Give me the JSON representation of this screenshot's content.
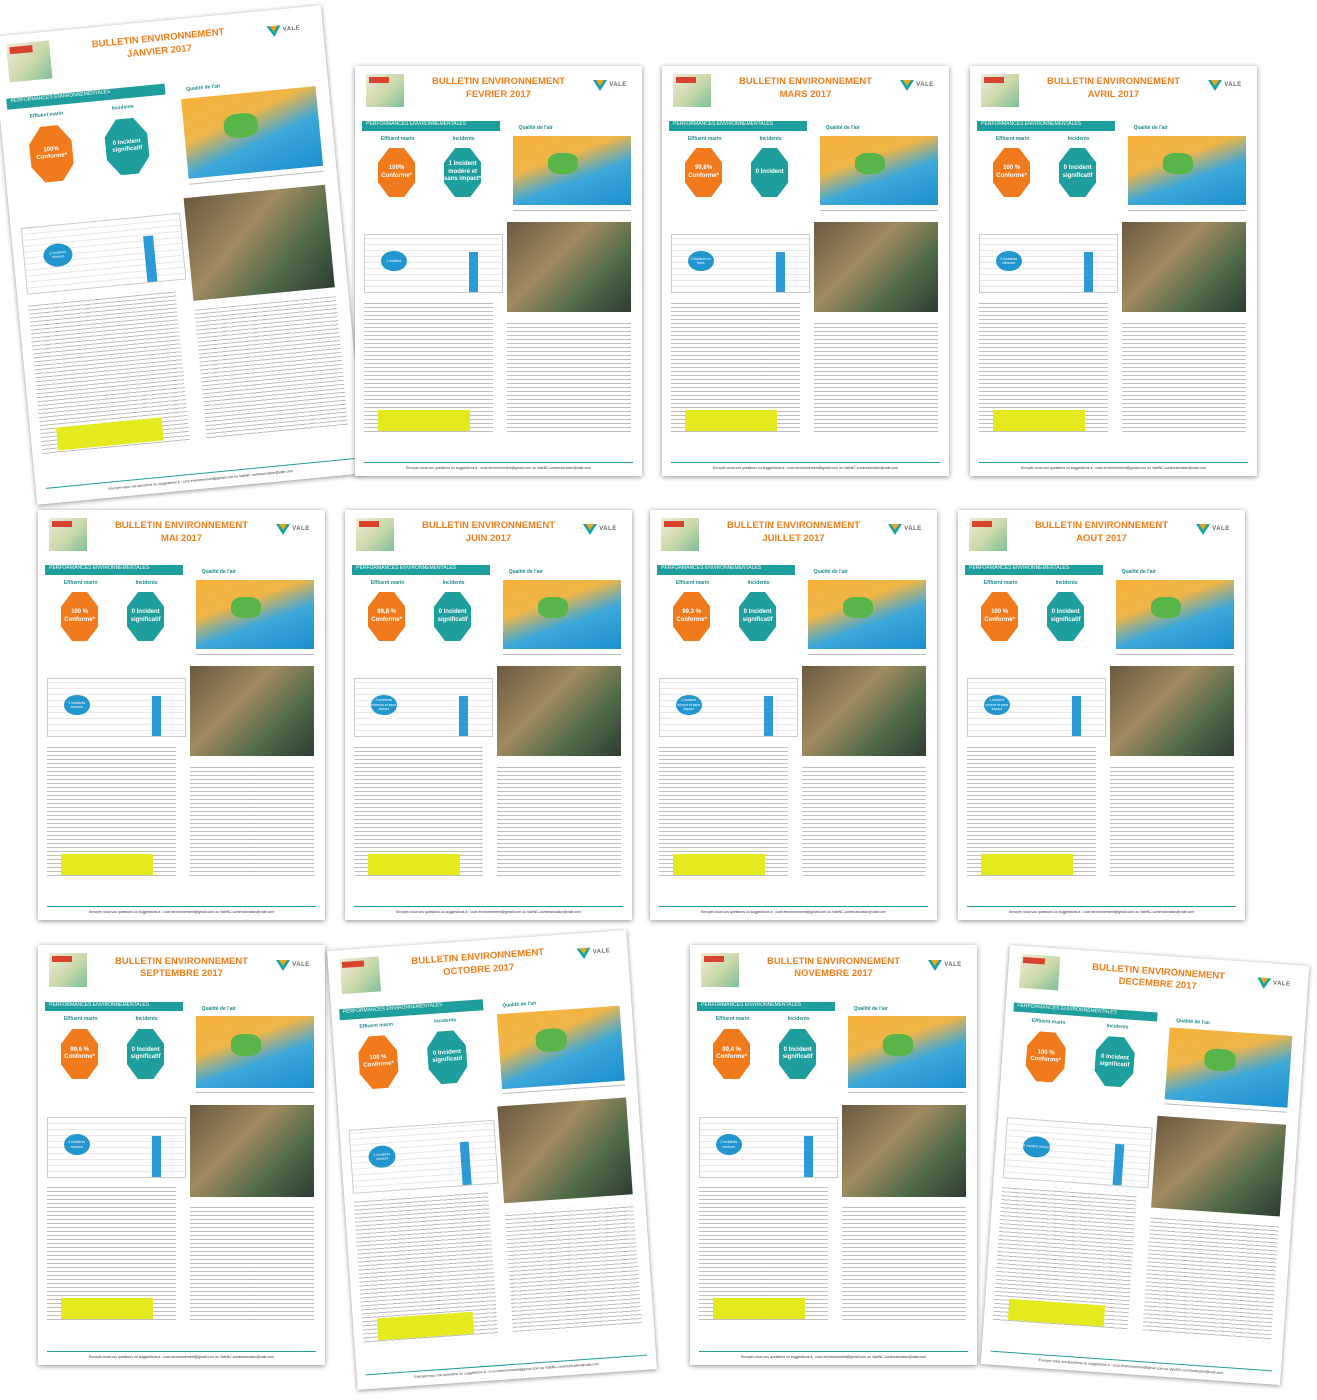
{
  "common": {
    "section_bar": "PERFORMANCES ENVIRONNEMENTALES",
    "effluent_label": "Effluent marin",
    "incidents_label": "Incidents",
    "air_label": "Qualité de l'air",
    "vale_text": "VALE",
    "footer": "Envoyer-nous vos questions ou suggestions à : ccce.environnement@gmail.com ou ValeNC-communication@vale.com"
  },
  "bulletins": [
    {
      "title": "BULLETIN ENVIRONNEMENT",
      "month": "JANVIER 2017",
      "effluent": "100% Conforme*",
      "incidents": "0 Incident significatif",
      "chip": "3 incidents mineurs"
    },
    {
      "title": "BULLETIN ENVIRONNEMENT",
      "month": "FEVRIER 2017",
      "effluent": "100% Conforme*",
      "incidents": "1 Incident modéré et sans impact*",
      "chip": "1 incident"
    },
    {
      "title": "BULLETIN ENVIRONNEMENT",
      "month": "MARS 2017",
      "effluent": "99,8% Conforme*",
      "incidents": "0 Incident",
      "chip": "0 incident en Mars"
    },
    {
      "title": "BULLETIN ENVIRONNEMENT",
      "month": "AVRIL 2017",
      "effluent": "100 % Conforme*",
      "incidents": "0 Incident significatif",
      "chip": "4 incidents mineurs"
    },
    {
      "title": "BULLETIN ENVIRONNEMENT",
      "month": "MAI 2017",
      "effluent": "100 % Conforme*",
      "incidents": "0 Incident significatif",
      "chip": "2 incidents mineurs"
    },
    {
      "title": "BULLETIN ENVIRONNEMENT",
      "month": "JUIN 2017",
      "effluent": "99,8 % Conforme*",
      "incidents": "0 Incident significatif",
      "chip": "2 incidents mineurs et sans impact"
    },
    {
      "title": "BULLETIN ENVIRONNEMENT",
      "month": "JUILLET 2017",
      "effluent": "99,3 % Conforme*",
      "incidents": "0 Incident significatif",
      "chip": "1 incident mineur et sans impact"
    },
    {
      "title": "BULLETIN ENVIRONNEMENT",
      "month": "AOUT 2017",
      "effluent": "100 % Conforme*",
      "incidents": "0 Incident significatif",
      "chip": "1 incident mineur et sans impact"
    },
    {
      "title": "BULLETIN ENVIRONNEMENT",
      "month": "SEPTEMBRE 2017",
      "effluent": "99,6 % Conforme*",
      "incidents": "0 Incident significatif",
      "chip": "4 incidents mineurs"
    },
    {
      "title": "BULLETIN ENVIRONNEMENT",
      "month": "OCTOBRE 2017",
      "effluent": "100 % Conforme*",
      "incidents": "0 Incident significatif",
      "chip": "2 incidents mineurs"
    },
    {
      "title": "BULLETIN ENVIRONNEMENT",
      "month": "NOVEMBRE 2017",
      "effluent": "99,4 % Conforme*",
      "incidents": "0 Incident significatif",
      "chip": "2 incidents mineurs"
    },
    {
      "title": "BULLETIN ENVIRONNEMENT",
      "month": "DECEMBRE 2017",
      "effluent": "100 % Conforme*",
      "incidents": "0 Incident significatif",
      "chip": "0 incident mineur"
    }
  ]
}
